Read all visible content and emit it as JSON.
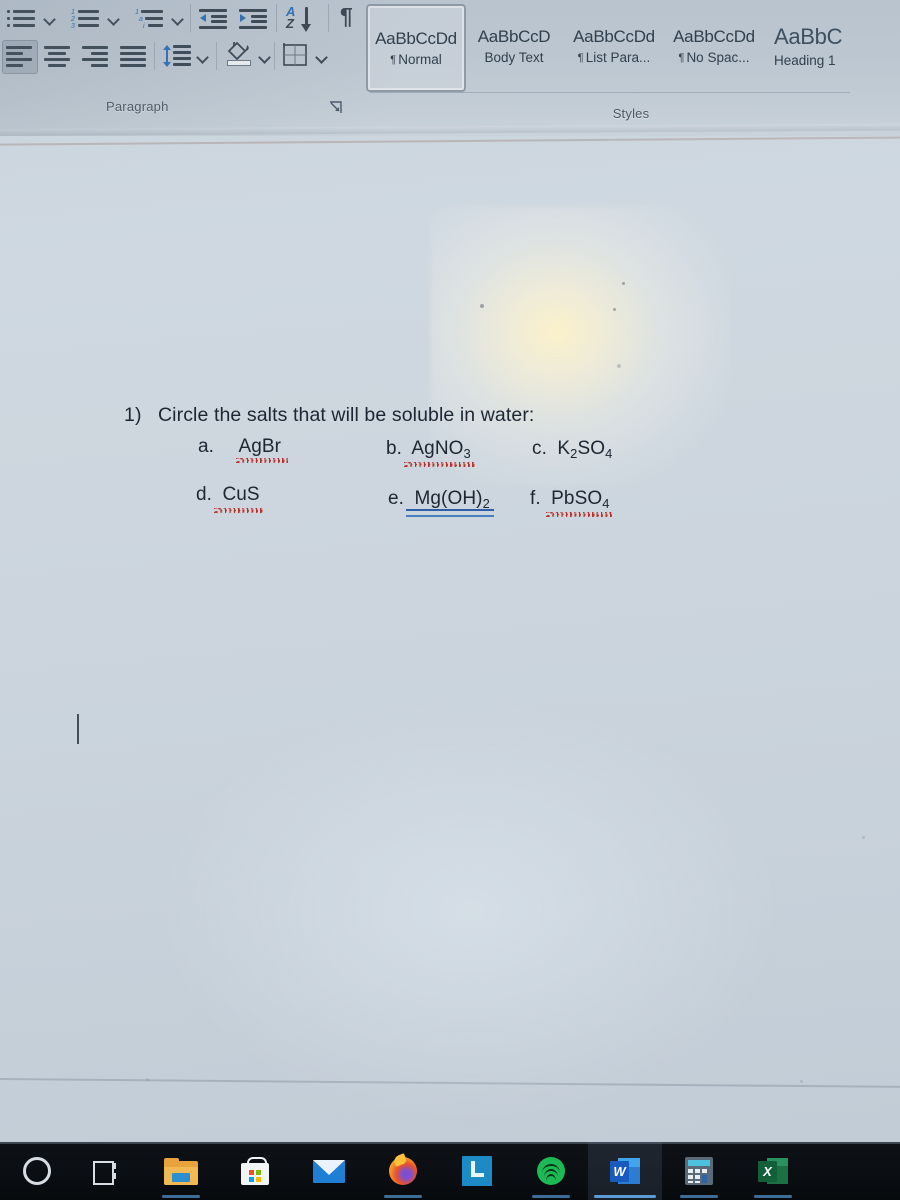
{
  "app": {
    "name": "Microsoft Word",
    "window_state": "photo-of-screen"
  },
  "ribbon": {
    "paragraph_group": {
      "label": "Paragraph",
      "dialog_launcher": "dialog-box-launcher",
      "row1": [
        {
          "name": "bullets",
          "tooltip": "Bullets",
          "has_dropdown": true
        },
        {
          "name": "numbering",
          "tooltip": "Numbering",
          "has_dropdown": true
        },
        {
          "name": "multilevel-list",
          "tooltip": "Multilevel List",
          "has_dropdown": true
        },
        {
          "name": "decrease-indent",
          "tooltip": "Decrease Indent",
          "has_dropdown": false
        },
        {
          "name": "increase-indent",
          "tooltip": "Increase Indent",
          "has_dropdown": false
        },
        {
          "name": "sort",
          "tooltip": "Sort",
          "has_dropdown": false
        },
        {
          "name": "show-hide-marks",
          "tooltip": "Show/Hide ¶",
          "has_dropdown": false
        }
      ],
      "row2": [
        {
          "name": "align-left",
          "tooltip": "Align Left",
          "selected": true
        },
        {
          "name": "align-center",
          "tooltip": "Center",
          "selected": false
        },
        {
          "name": "align-right",
          "tooltip": "Align Right",
          "selected": false
        },
        {
          "name": "justify",
          "tooltip": "Justify",
          "selected": false
        },
        {
          "name": "line-spacing",
          "tooltip": "Line and Paragraph Spacing",
          "has_dropdown": true
        },
        {
          "name": "shading",
          "tooltip": "Shading",
          "has_dropdown": true
        },
        {
          "name": "borders",
          "tooltip": "Borders",
          "has_dropdown": true
        }
      ]
    },
    "styles_group": {
      "label": "Styles",
      "items": [
        {
          "preview": "AaBbCcDd",
          "name": "Normal",
          "pilcrow": true,
          "selected": true,
          "size": "normal"
        },
        {
          "preview": "AaBbCcD",
          "name": "Body Text",
          "pilcrow": false,
          "selected": false,
          "size": "normal"
        },
        {
          "preview": "AaBbCcDd",
          "name": "List Para...",
          "pilcrow": true,
          "selected": false,
          "size": "normal"
        },
        {
          "preview": "AaBbCcDd",
          "name": "No Spac...",
          "pilcrow": true,
          "selected": false,
          "size": "normal"
        },
        {
          "preview": "AaBbC",
          "name": "Heading 1",
          "pilcrow": false,
          "selected": false,
          "size": "big"
        }
      ]
    }
  },
  "document": {
    "question": {
      "number": "1)",
      "prompt": "Circle the salts that will be soluble in water:"
    },
    "options": [
      {
        "label": "a.",
        "formula": "AgBr",
        "base": "AgBr",
        "sub": "",
        "tail": "",
        "spellcheck": "red-wavy"
      },
      {
        "label": "b.",
        "formula": "AgNO3",
        "base": "AgNO",
        "sub": "3",
        "tail": "",
        "spellcheck": "red-wavy"
      },
      {
        "label": "c.",
        "formula": "K2SO4",
        "base": "K",
        "sub": "2",
        "tail": "SO",
        "sub2": "4",
        "spellcheck": "none"
      },
      {
        "label": "d.",
        "formula": "CuS",
        "base": "CuS",
        "sub": "",
        "tail": "",
        "spellcheck": "red-wavy"
      },
      {
        "label": "e.",
        "formula": "Mg(OH)2",
        "base": "Mg",
        "sub": "",
        "tail": "(OH)",
        "sub2": "2",
        "spellcheck": "blue-double"
      },
      {
        "label": "f.",
        "formula": "PbSO4",
        "base": "PbSO",
        "sub": "4",
        "tail": "",
        "spellcheck": "red-wavy"
      }
    ],
    "caret": {
      "name": "text-cursor",
      "visible": true
    }
  },
  "taskbar": {
    "items": [
      {
        "name": "cortana",
        "label": "Cortana",
        "active": false,
        "running": false
      },
      {
        "name": "task-view",
        "label": "Task View",
        "active": false,
        "running": false
      },
      {
        "name": "file-explorer",
        "label": "File Explorer",
        "active": false,
        "running": true
      },
      {
        "name": "microsoft-store",
        "label": "Microsoft Store",
        "active": false,
        "running": false
      },
      {
        "name": "mail",
        "label": "Mail",
        "active": false,
        "running": false
      },
      {
        "name": "firefox",
        "label": "Firefox",
        "active": false,
        "running": true
      },
      {
        "name": "lockdown-browser",
        "label": "LockDown Browser",
        "active": false,
        "running": false
      },
      {
        "name": "spotify",
        "label": "Spotify",
        "active": false,
        "running": true
      },
      {
        "name": "word",
        "label": "Word",
        "active": true,
        "running": true
      },
      {
        "name": "calculator",
        "label": "Calculator",
        "active": false,
        "running": true
      },
      {
        "name": "excel",
        "label": "Excel",
        "active": false,
        "running": true
      }
    ]
  },
  "colors": {
    "ribbon_bg": "#bcc6d0",
    "page_bg": "#ccd6de",
    "text": "#1d2733",
    "accent_blue": "#2f6fb5",
    "spell_red": "#c0392b",
    "grammar_blue": "#2f5fa8",
    "taskbar_bg": "#0b0e12",
    "taskbar_underline": "#5b9bd5",
    "glare": "#fff3c8"
  }
}
